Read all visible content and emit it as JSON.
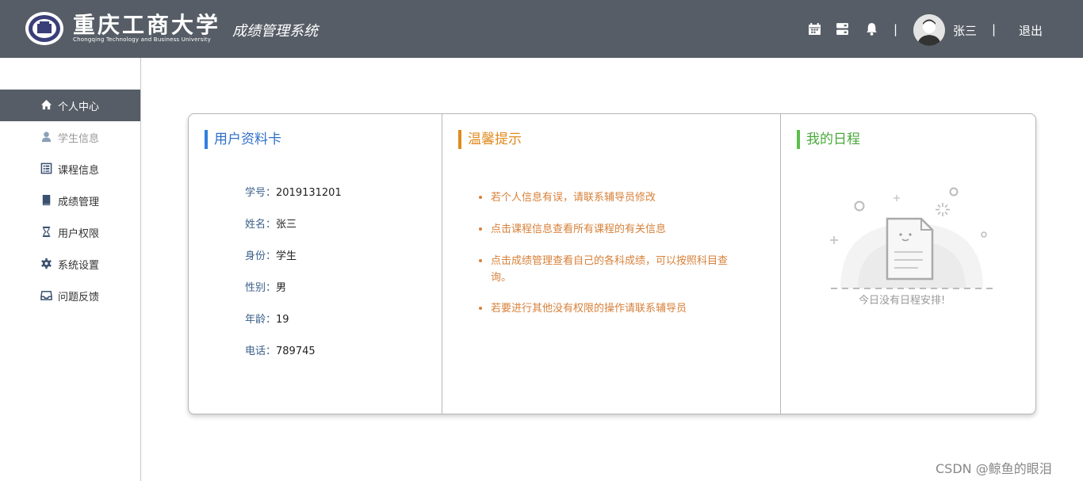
{
  "header": {
    "school_name_cn": "重庆工商大学",
    "school_name_en": "Chongqing Technology and Business University",
    "system_title": "成绩管理系统",
    "icons": [
      "calendar-icon",
      "server-icon",
      "bell-icon"
    ],
    "separator": "|",
    "username": "张三",
    "logout_label": "退出"
  },
  "sidebar": {
    "items": [
      {
        "label": "个人中心",
        "icon": "home-icon",
        "active": true
      },
      {
        "label": "学生信息",
        "icon": "user-icon",
        "active": false
      },
      {
        "label": "课程信息",
        "icon": "list-icon",
        "active": false
      },
      {
        "label": "成绩管理",
        "icon": "book-icon",
        "active": false
      },
      {
        "label": "用户权限",
        "icon": "hourglass-icon",
        "active": false
      },
      {
        "label": "系统设置",
        "icon": "gear-icon",
        "active": false
      },
      {
        "label": "问题反馈",
        "icon": "inbox-icon",
        "active": false
      }
    ]
  },
  "profile": {
    "title": "用户资料卡",
    "rows": [
      {
        "label": "学号：",
        "value": "2019131201"
      },
      {
        "label": "姓名：",
        "value": "张三"
      },
      {
        "label": "身份：",
        "value": "学生"
      },
      {
        "label": "性别：",
        "value": "男"
      },
      {
        "label": "年龄：",
        "value": "19"
      },
      {
        "label": "电话：",
        "value": "789745"
      }
    ]
  },
  "tips": {
    "title": "温馨提示",
    "items": [
      "若个人信息有误，请联系辅导员修改",
      "点击课程信息查看所有课程的有关信息",
      "点击成绩管理查看自己的各科成绩，可以按照科目查询。",
      "若要进行其他没有权限的操作请联系辅导员"
    ]
  },
  "schedule": {
    "title": "我的日程",
    "empty_text": "今日没有日程安排!"
  },
  "colors": {
    "header_bg": "#565d66",
    "profile_accent": "#2f7fe0",
    "tips_accent": "#e08a1e",
    "schedule_accent": "#5bbf4a",
    "tip_text": "#d7813a"
  },
  "watermark": "CSDN @鲸鱼的眼泪"
}
